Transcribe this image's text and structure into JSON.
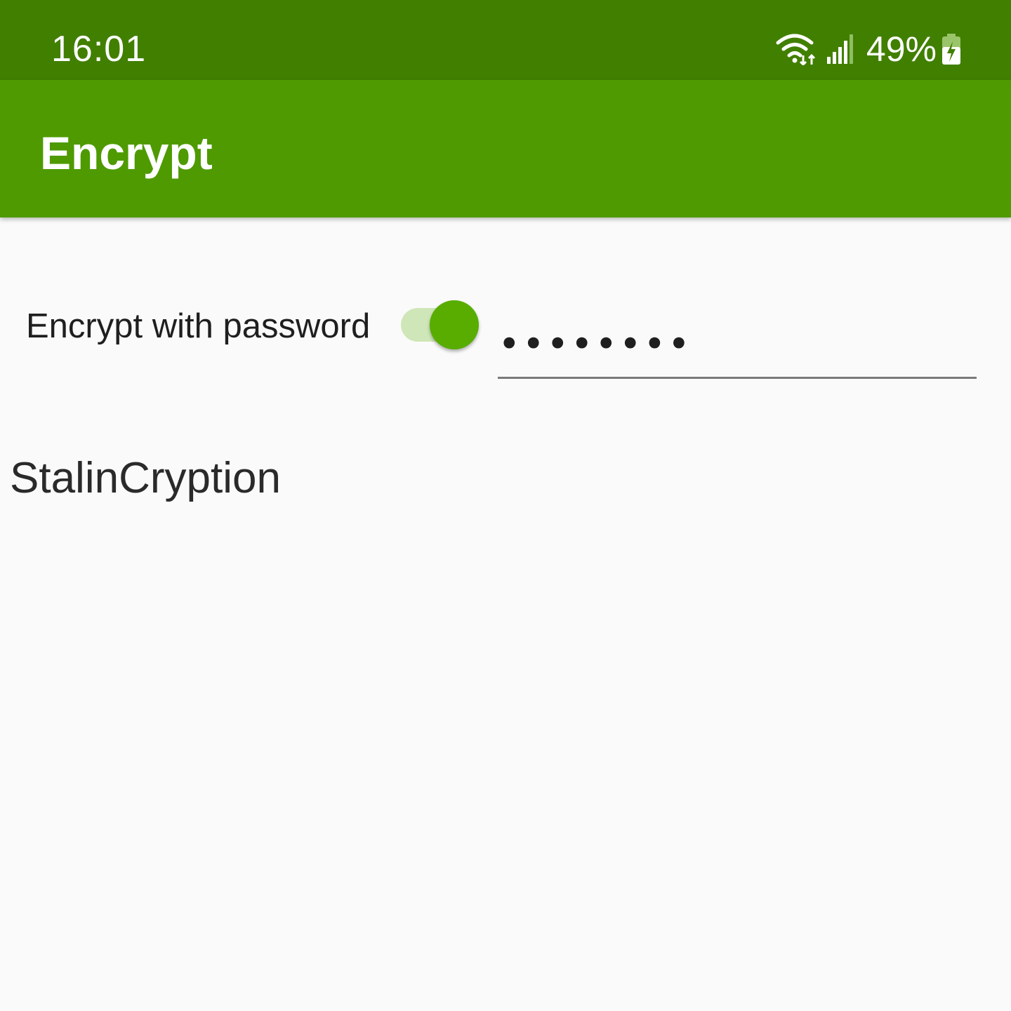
{
  "status_bar": {
    "time": "16:01",
    "battery_percent": "49%",
    "icons": [
      "wifi-icon",
      "signal-icon",
      "battery-charging-icon"
    ]
  },
  "app_bar": {
    "title": "Encrypt"
  },
  "options": {
    "switch_label": "Encrypt with password",
    "switch_on": true,
    "password_value": "••••••••"
  },
  "output": {
    "text": "StalinCryption"
  },
  "colors": {
    "status_bar": "#417f00",
    "app_bar": "#4e9a00",
    "switch_thumb": "#58ad00",
    "switch_track": "#cfe6b8",
    "background": "#fafafa"
  }
}
